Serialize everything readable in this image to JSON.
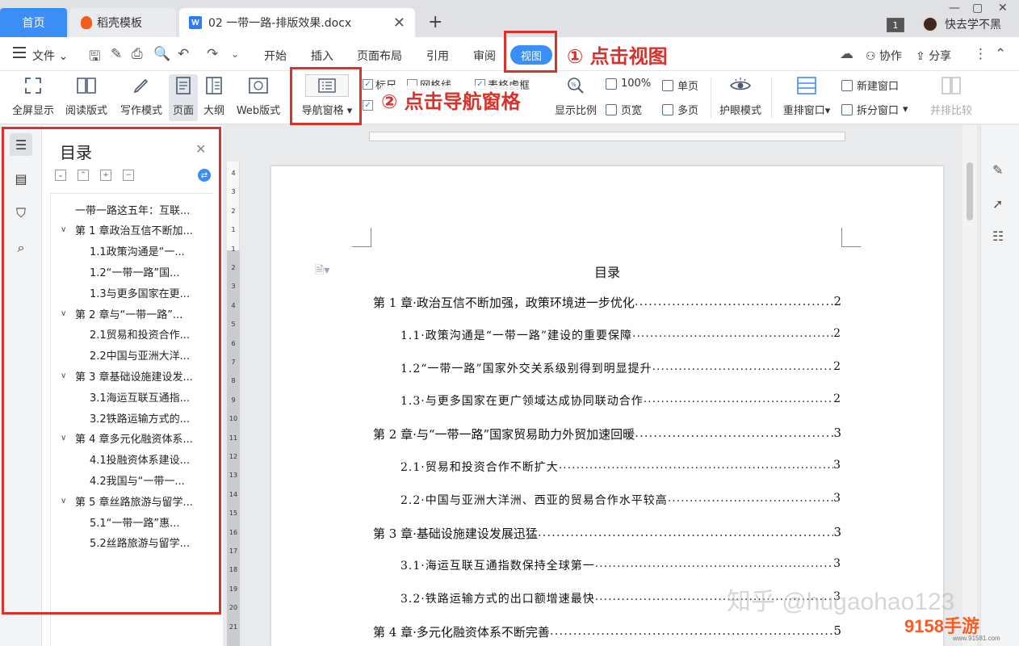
{
  "tabs": {
    "home": "首页",
    "template": "稻壳模板",
    "document": "02 一带一路-排版效果.docx",
    "new_tab": "+",
    "close": "✕",
    "count": "1"
  },
  "user": {
    "name": "快去学不黑"
  },
  "menu": {
    "file": "文件",
    "items": [
      "开始",
      "插入",
      "页面布局",
      "引用",
      "审阅",
      "视图"
    ],
    "active": "视图",
    "collab": "协作",
    "share": "分享"
  },
  "annotations": {
    "step1": "① 点击视图",
    "step2": "② 点击导航窗格",
    "color": "#d9312b"
  },
  "toolbar": {
    "fullscreen": "全屏显示",
    "reading": "阅读版式",
    "writing": "写作模式",
    "page": "页面",
    "outline": "大纲",
    "web": "Web版式",
    "nav_pane": "导航窗格",
    "ruler": "标尺",
    "gridlines": "网格线",
    "table_border": "表格虚框",
    "zoom": "显示比例",
    "zoom_100": "100%",
    "single_page": "单页",
    "page_width": "页宽",
    "multi_page": "多页",
    "eye_mode": "护眼模式",
    "rearrange": "重排窗口",
    "new_window": "新建窗口",
    "split_window": "拆分窗口",
    "side_by_side": "并排比较"
  },
  "nav": {
    "title": "目录",
    "items": [
      {
        "label": "一带一路这五年：互联...",
        "level": 0
      },
      {
        "label": "第 1 章政治互信不断加...",
        "level": 1
      },
      {
        "label": "1.1政策沟通是“一...",
        "level": 2
      },
      {
        "label": "1.2“一带一路”国...",
        "level": 2
      },
      {
        "label": "1.3与更多国家在更...",
        "level": 2
      },
      {
        "label": "第 2 章与“一带一路”...",
        "level": 1
      },
      {
        "label": "2.1贸易和投资合作...",
        "level": 2
      },
      {
        "label": "2.2中国与亚洲大洋...",
        "level": 2
      },
      {
        "label": "第 3 章基础设施建设发...",
        "level": 1
      },
      {
        "label": "3.1海运互联互通指...",
        "level": 2
      },
      {
        "label": "3.2铁路运输方式的...",
        "level": 2
      },
      {
        "label": "第 4 章多元化融资体系...",
        "level": 1
      },
      {
        "label": "4.1投融资体系建设...",
        "level": 2
      },
      {
        "label": "4.2我国与“一带一...",
        "level": 2
      },
      {
        "label": "第 5 章丝路旅游与留学...",
        "level": 1
      },
      {
        "label": "5.1“一带一路”惠...",
        "level": 2
      },
      {
        "label": "5.2丝路旅游与留学...",
        "level": 2
      }
    ]
  },
  "ruler_numbers": [
    "4",
    "3",
    "2",
    "1",
    "1",
    "2",
    "3",
    "4",
    "5",
    "6",
    "7",
    "8",
    "9",
    "10",
    "11",
    "12",
    "13",
    "14",
    "15",
    "16",
    "17",
    "18",
    "19",
    "20",
    "21"
  ],
  "document": {
    "title": "目录",
    "toc": [
      {
        "text": "第 1 章·政治互信不断加强，政策环境进一步优化",
        "page": "2",
        "sub": false
      },
      {
        "text": "1.1·政策沟通是“一带一路”建设的重要保障",
        "page": "2",
        "sub": true
      },
      {
        "text": "1.2“一带一路”国家外交关系级别得到明显提升",
        "page": "2",
        "sub": true
      },
      {
        "text": "1.3·与更多国家在更广领域达成协同联动合作",
        "page": "2",
        "sub": true
      },
      {
        "text": "第 2 章·与“一带一路”国家贸易助力外贸加速回暖",
        "page": "3",
        "sub": false
      },
      {
        "text": "2.1·贸易和投资合作不断扩大",
        "page": "3",
        "sub": true
      },
      {
        "text": "2.2·中国与亚洲大洋洲、西亚的贸易合作水平较高",
        "page": "3",
        "sub": true
      },
      {
        "text": "第 3 章·基础设施建设发展迅猛",
        "page": "3",
        "sub": false
      },
      {
        "text": "3.1·海运互联互通指数保持全球第一",
        "page": "3",
        "sub": true
      },
      {
        "text": "3.2·铁路运输方式的出口额增速最快",
        "page": "3",
        "sub": true
      },
      {
        "text": "第 4 章·多元化融资体系不断完善",
        "page": "5",
        "sub": false
      }
    ]
  },
  "watermark": {
    "text": "知乎 @hugaohao123",
    "brand": "9158手游",
    "brand_url": "www.91581.com"
  }
}
